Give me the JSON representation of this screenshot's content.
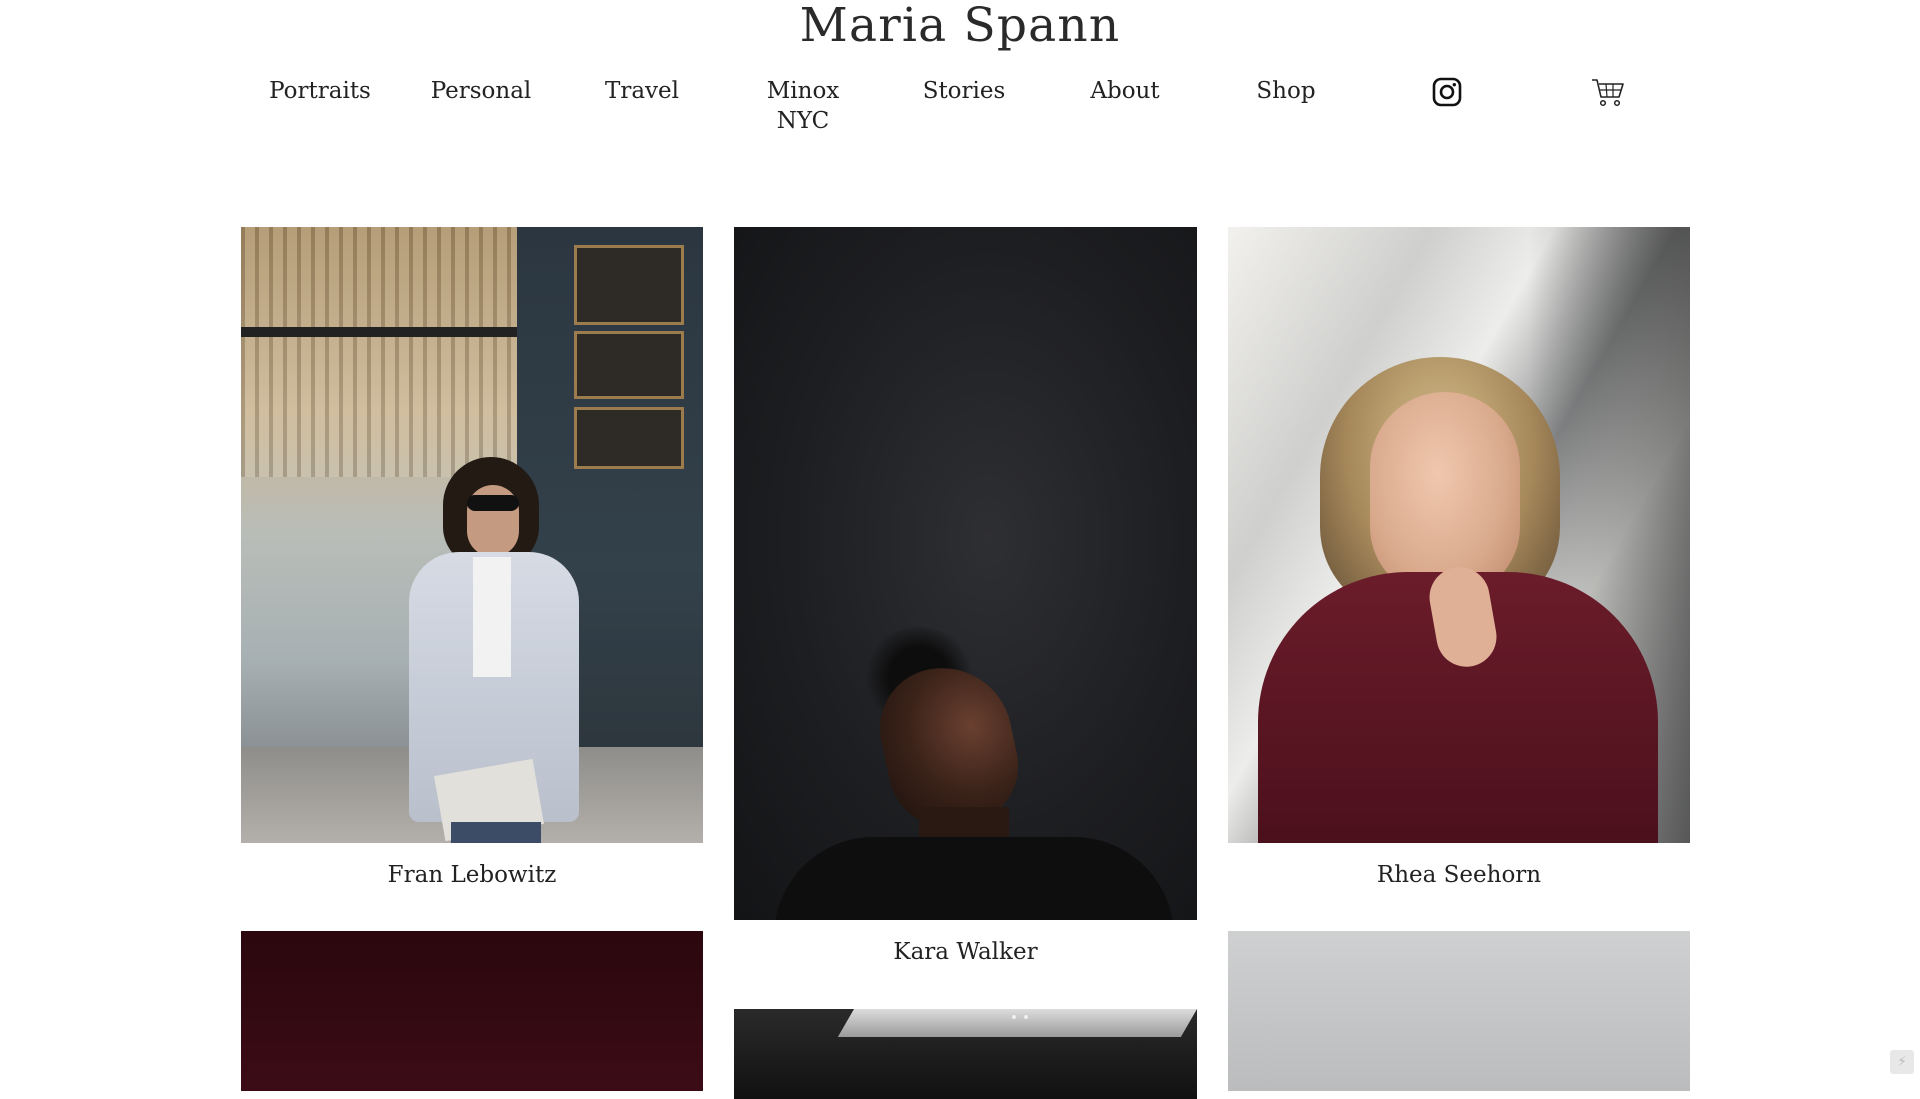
{
  "site": {
    "title": "Maria Spann"
  },
  "nav": {
    "items": [
      {
        "label": "Portraits"
      },
      {
        "label": "Personal"
      },
      {
        "label": "Travel"
      },
      {
        "label": "Minox NYC"
      },
      {
        "label": "Stories"
      },
      {
        "label": "About"
      },
      {
        "label": "Shop"
      }
    ],
    "icons": [
      "instagram-icon",
      "cart-icon"
    ]
  },
  "gallery": {
    "items": [
      {
        "caption": "Fran Lebowitz"
      },
      {
        "caption": "Kara Walker"
      },
      {
        "caption": "Rhea Seehorn"
      }
    ]
  },
  "colors": {
    "background": "#ffffff",
    "text": "#222222"
  }
}
